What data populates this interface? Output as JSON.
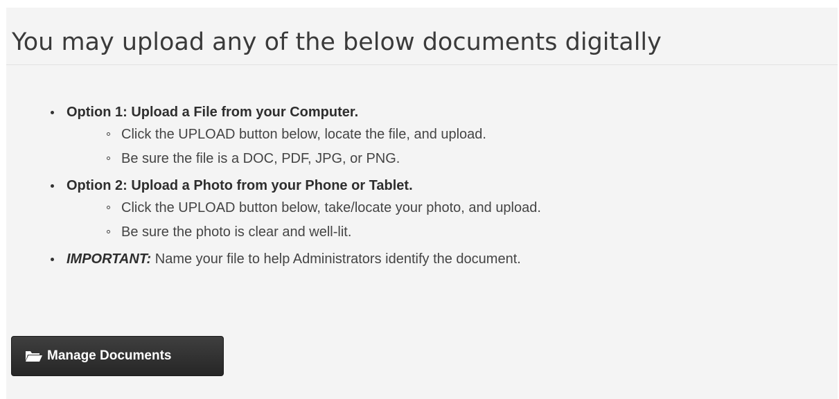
{
  "page": {
    "heading": "You may upload any of the below documents digitally"
  },
  "options": [
    {
      "title": "Option 1: Upload a File from your Computer.",
      "steps": [
        "Click the UPLOAD button below, locate the file, and upload.",
        "Be sure the file is a DOC, PDF, JPG, or PNG."
      ]
    },
    {
      "title": "Option 2: Upload a Photo from your Phone or Tablet.",
      "steps": [
        "Click the UPLOAD button below, take/locate your photo, and upload.",
        "Be sure the photo is clear and well-lit."
      ]
    }
  ],
  "important": {
    "label": "IMPORTANT:",
    "text": " Name your file to help Administrators identify the document."
  },
  "actions": {
    "manage_documents_label": "Manage Documents",
    "manage_documents_icon": "folder-open-icon"
  },
  "colors": {
    "panel_background": "#f4f4f4",
    "button_background": "#2f2f2f",
    "button_text": "#ffffff",
    "heading_text": "#3a3a3a"
  }
}
